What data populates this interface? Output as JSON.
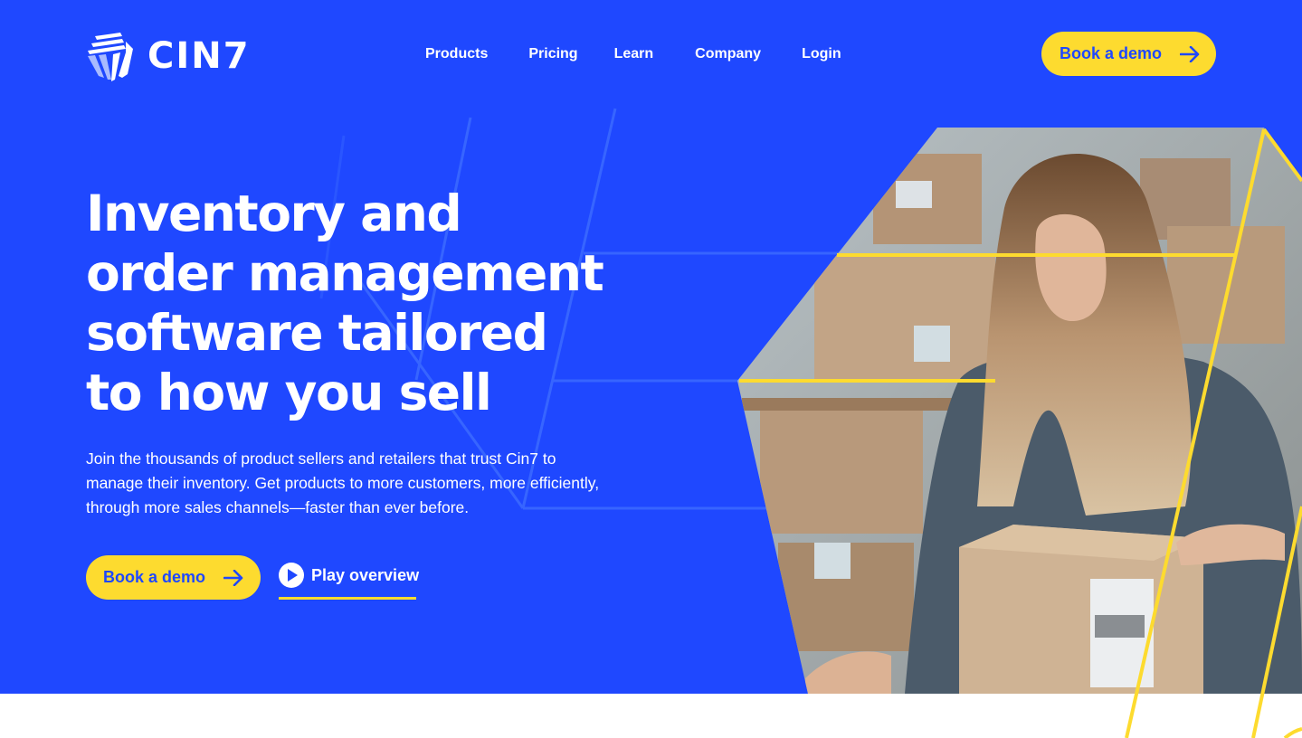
{
  "brand": {
    "name": "CIN7",
    "logo_icon": "cin7-stripes-logo-icon"
  },
  "colors": {
    "primary_blue": "#1f48ff",
    "accent_yellow": "#fddb2f",
    "text_white": "#ffffff",
    "line_blue": "#3c7bff"
  },
  "nav": {
    "items": [
      {
        "label": "Products"
      },
      {
        "label": "Pricing"
      },
      {
        "label": "Learn"
      },
      {
        "label": "Company"
      },
      {
        "label": "Login"
      }
    ],
    "cta_label": "Book a demo",
    "cta_icon": "arrow-right-icon"
  },
  "hero": {
    "headline_lines": [
      "Inventory and",
      "order management",
      "software tailored",
      "to how you sell"
    ],
    "subtext_lines": [
      "Join the thousands of product sellers and retailers that trust Cin7 to",
      "manage their inventory. Get products to more customers, more efficiently,",
      "through more sales channels—faster than ever before."
    ],
    "primary_cta_label": "Book a demo",
    "secondary_cta_label": "Play overview",
    "secondary_cta_icon": "play-circle-icon",
    "image_description": "Woman with long hair packing a cardboard box in a warehouse with shelves of boxes"
  }
}
